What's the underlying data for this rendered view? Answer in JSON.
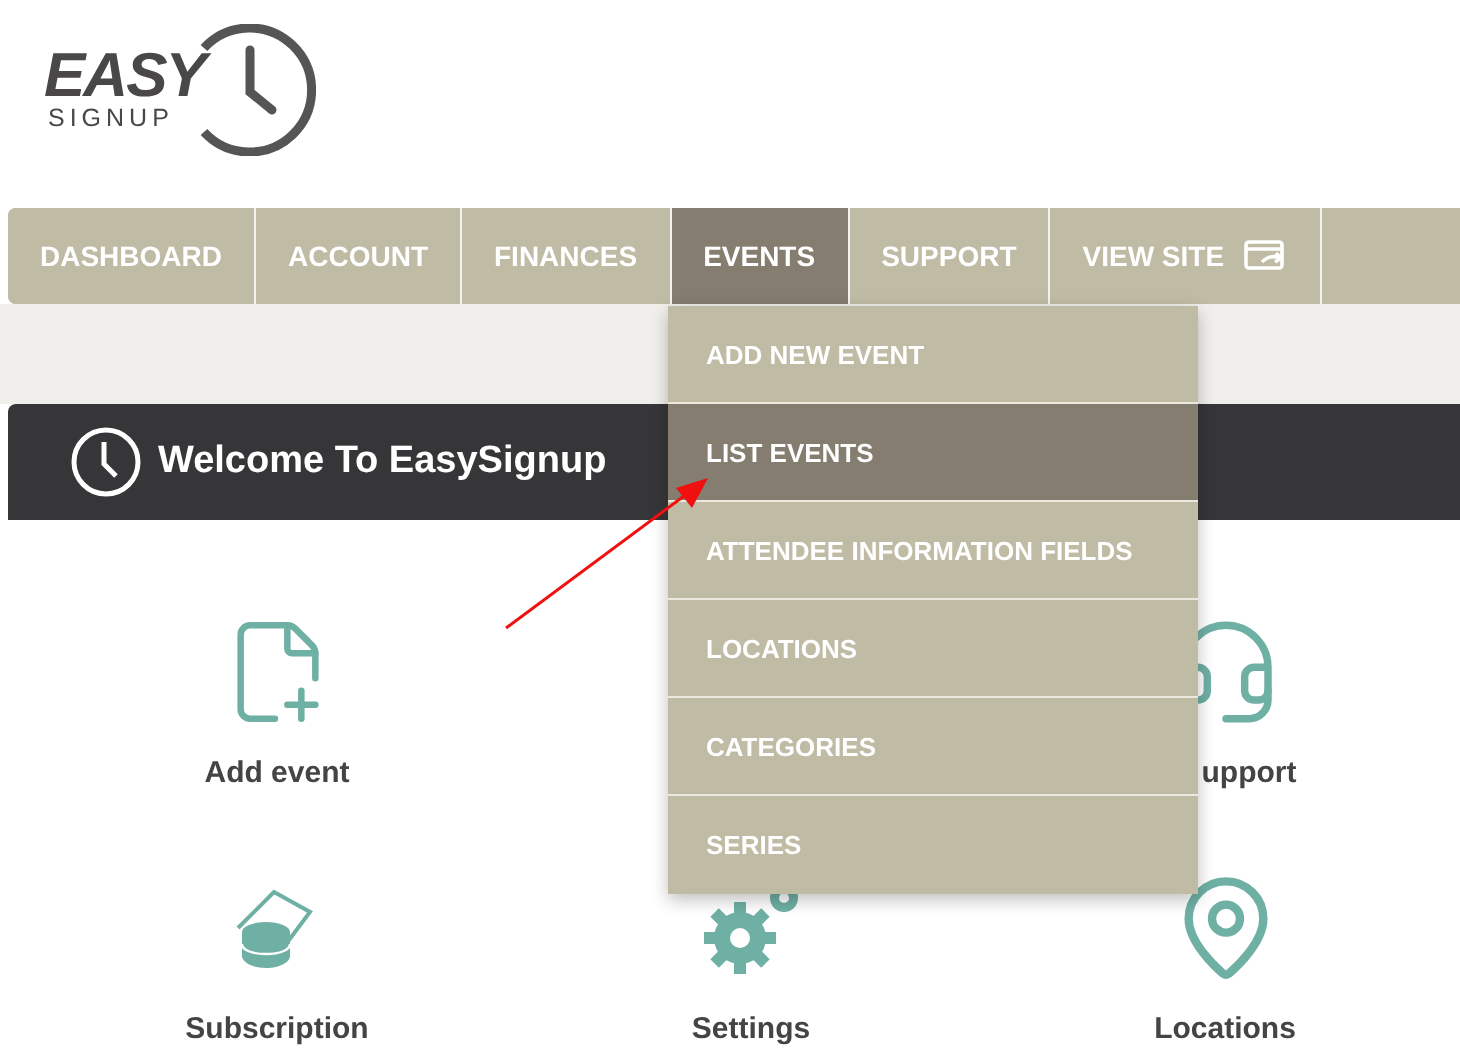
{
  "logo": {
    "word": "EASY",
    "subword": "SIGNUP"
  },
  "nav": [
    {
      "label": "DASHBOARD",
      "selected": false
    },
    {
      "label": "ACCOUNT",
      "selected": false
    },
    {
      "label": "FINANCES",
      "selected": false
    },
    {
      "label": "EVENTS",
      "selected": true
    },
    {
      "label": "SUPPORT",
      "selected": false
    },
    {
      "label": "VIEW SITE",
      "selected": false,
      "kind": "external"
    }
  ],
  "dropdown": [
    {
      "label": "ADD NEW EVENT",
      "selected": false
    },
    {
      "label": "LIST EVENTS",
      "selected": true
    },
    {
      "label": "ATTENDEE INFORMATION FIELDS",
      "selected": false
    },
    {
      "label": "LOCATIONS",
      "selected": false
    },
    {
      "label": "CATEGORIES",
      "selected": false
    },
    {
      "label": "SERIES",
      "selected": false
    }
  ],
  "card": {
    "title": "Welcome To EasySignup",
    "shortcuts": [
      {
        "label": "Add event",
        "kind": "add"
      },
      {
        "label": "upport",
        "kind": "support",
        "partial": true
      },
      {
        "label": "Subscription",
        "kind": "subscription"
      },
      {
        "label": "Settings",
        "kind": "settings"
      },
      {
        "label": "Locations",
        "kind": "location"
      }
    ]
  }
}
